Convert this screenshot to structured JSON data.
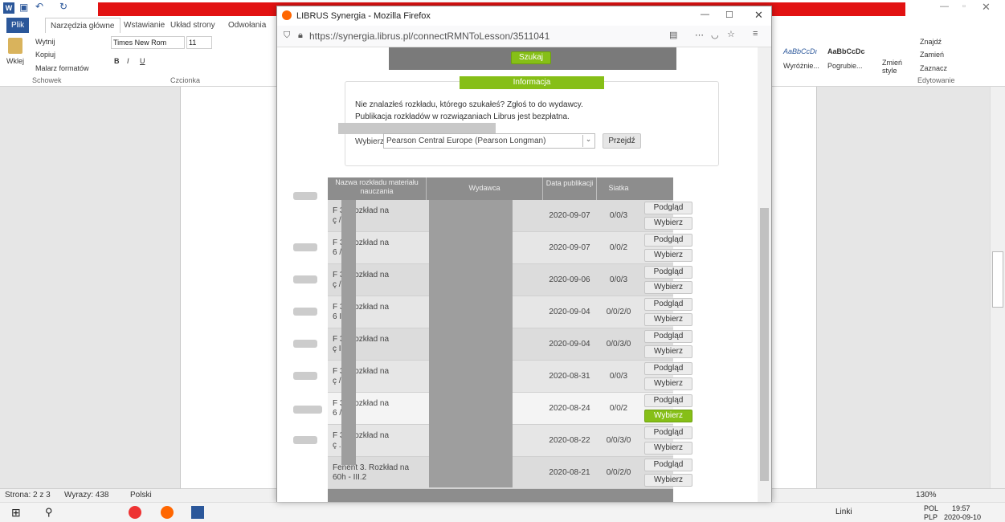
{
  "word": {
    "tabs": [
      "Plik",
      "Narzędzia główne",
      "Wstawianie",
      "Układ strony",
      "Odwołania"
    ],
    "clipboard": {
      "cut": "Wytnij",
      "copy": "Kopiuj",
      "paste": "Wklej",
      "painter": "Malarz formatów",
      "group": "Schowek"
    },
    "font": {
      "name": "Times New Rom",
      "size": "11",
      "group": "Czcionka"
    },
    "styles": {
      "s1": "AaBbCcDı",
      "s2": "AaBbCcDc",
      "l1": "Wyróżnie...",
      "l2": "Pogrubie...",
      "change": "Zmień style"
    },
    "editing": {
      "find": "Znajdź",
      "replace": "Zamień",
      "select": "Zaznacz",
      "group": "Edytowanie"
    },
    "status": {
      "page": "Strona: 2 z 3",
      "words": "Wyrazy: 438",
      "lang": "Polski",
      "zoom": "130%"
    },
    "taskbar": {
      "links": "Linki",
      "lang1": "POL",
      "lang2": "PLP",
      "time": "19:57",
      "date": "2020-09-10"
    }
  },
  "firefox": {
    "title": "LIBRUS Synergia - Mozilla Firefox",
    "url": "https://synergia.librus.pl/connectRMNToLesson/3511041"
  },
  "page": {
    "search_button": "Szukaj",
    "info_header": "Informacja",
    "info_line1": "Nie znalazłeś rozkładu, którego szukałeś? Zgłoś to do wydawcy.",
    "info_line2": "Publikacja rozkładów w rozwiązaniach Librus jest bezpłatna.",
    "select_label": "Wybierz",
    "select_value": "Pearson Central Europe (Pearson Longman)",
    "go_button": "Przejdź",
    "columns": [
      "Nazwa rozkładu materiału nauczania",
      "Wydawca",
      "Data publikacji",
      "Siatka"
    ],
    "preview": "Podgląd",
    "choose": "Wybierz",
    "rows": [
      {
        "name1": "F   3. Rozkład na",
        "name2": "ç    /.0",
        "date": "2020-09-07",
        "grid": "0/0/3"
      },
      {
        "name1": "F   3. Rozkład na",
        "name2": "6    /.0",
        "date": "2020-09-07",
        "grid": "0/0/2"
      },
      {
        "name1": "F   3. Rozkład na",
        "name2": "ç    /.0",
        "date": "2020-09-06",
        "grid": "0/0/3"
      },
      {
        "name1": "F   3. Rozkład na",
        "name2": "6    I.2.0",
        "date": "2020-09-04",
        "grid": "0/0/2/0"
      },
      {
        "name1": "F   3. Rozkład na",
        "name2": "ç    I.2.0",
        "date": "2020-09-04",
        "grid": "0/0/3/0"
      },
      {
        "name1": "F   3. Rozkład na",
        "name2": "ç    /I. P",
        "date": "2020-08-31",
        "grid": "0/0/3"
      },
      {
        "name1": "F   3. Rozkład na",
        "name2": "6    /.1.P",
        "date": "2020-08-24",
        "grid": "0/0/2"
      },
      {
        "name1": "F   3. Rozkład na",
        "name2": "ç    .2",
        "date": "2020-08-22",
        "grid": "0/0/3/0"
      },
      {
        "name1": "Fenent 3. Rozkład na",
        "name2": "60h - III.2",
        "date": "2020-08-21",
        "grid": "0/0/2/0"
      }
    ]
  }
}
